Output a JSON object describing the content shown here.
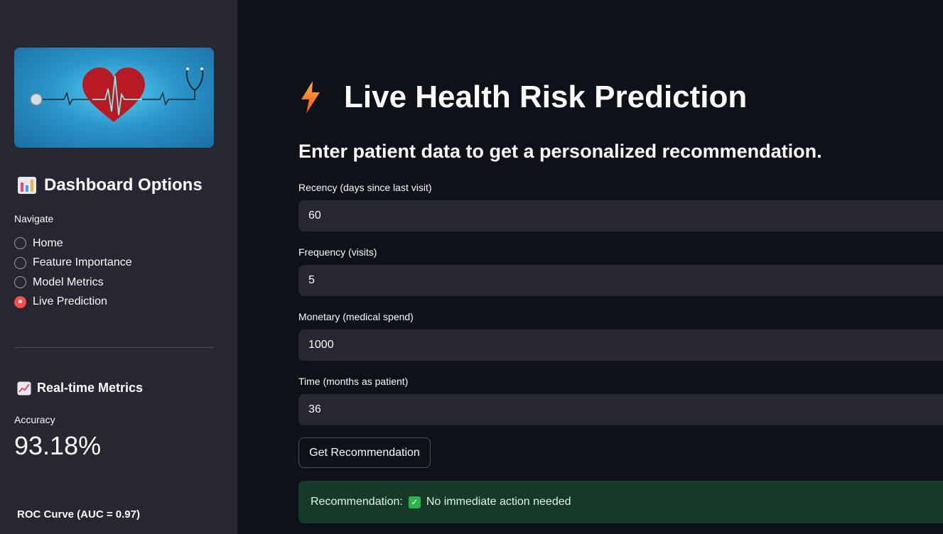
{
  "sidebar": {
    "title": "Dashboard Options",
    "nav_label": "Navigate",
    "nav_items": [
      {
        "label": "Home",
        "selected": false
      },
      {
        "label": "Feature Importance",
        "selected": false
      },
      {
        "label": "Model Metrics",
        "selected": false
      },
      {
        "label": "Live Prediction",
        "selected": true
      }
    ],
    "metrics_title": "Real-time Metrics",
    "accuracy_label": "Accuracy",
    "accuracy_value": "93.18%",
    "roc_title": "ROC Curve (AUC = 0.97)"
  },
  "main": {
    "title": "Live Health Risk Prediction",
    "subtitle": "Enter patient data to get a personalized recommendation.",
    "fields": [
      {
        "label": "Recency (days since last visit)",
        "value": "60"
      },
      {
        "label": "Frequency (visits)",
        "value": "5"
      },
      {
        "label": "Monetary (medical spend)",
        "value": "1000"
      },
      {
        "label": "Time (months as patient)",
        "value": "36"
      }
    ],
    "button_label": "Get Recommendation",
    "result_label": "Recommendation:",
    "result_text": "No immediate action needed"
  },
  "colors": {
    "accent": "#ff4b4b",
    "success_bg": "#173928",
    "sidebar_bg": "#262730",
    "main_bg": "#0e1117"
  },
  "icons": [
    "heart-banner",
    "bar-chart-icon",
    "line-chart-icon",
    "lightning-icon",
    "check-icon"
  ]
}
